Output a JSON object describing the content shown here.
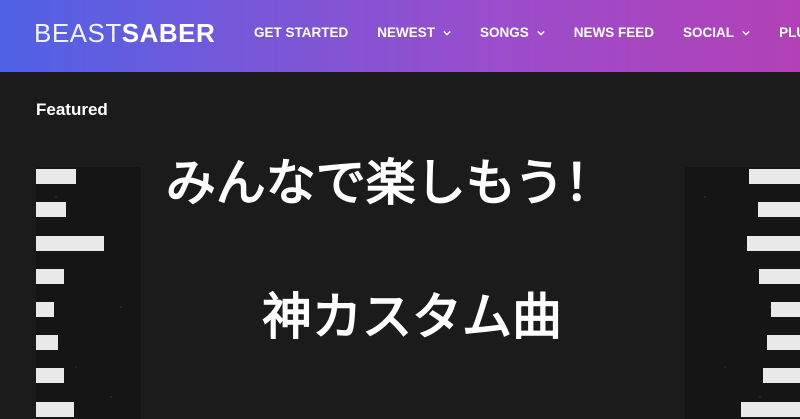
{
  "header": {
    "logo": {
      "light": "BEAST",
      "bold": "SABER"
    },
    "nav": [
      {
        "label": "GET STARTED",
        "has_dropdown": false
      },
      {
        "label": "NEWEST",
        "has_dropdown": true
      },
      {
        "label": "SONGS",
        "has_dropdown": true
      },
      {
        "label": "NEWS FEED",
        "has_dropdown": false
      },
      {
        "label": "SOCIAL",
        "has_dropdown": true
      },
      {
        "label": "PLUGI",
        "has_dropdown": false
      }
    ],
    "colors": {
      "gradient_start": "#4f62e6",
      "gradient_end": "#b241b6"
    }
  },
  "featured": {
    "title": "Featured",
    "banner_line1": "みんなで楽しもう！",
    "banner_line2": "神カスタム曲"
  }
}
